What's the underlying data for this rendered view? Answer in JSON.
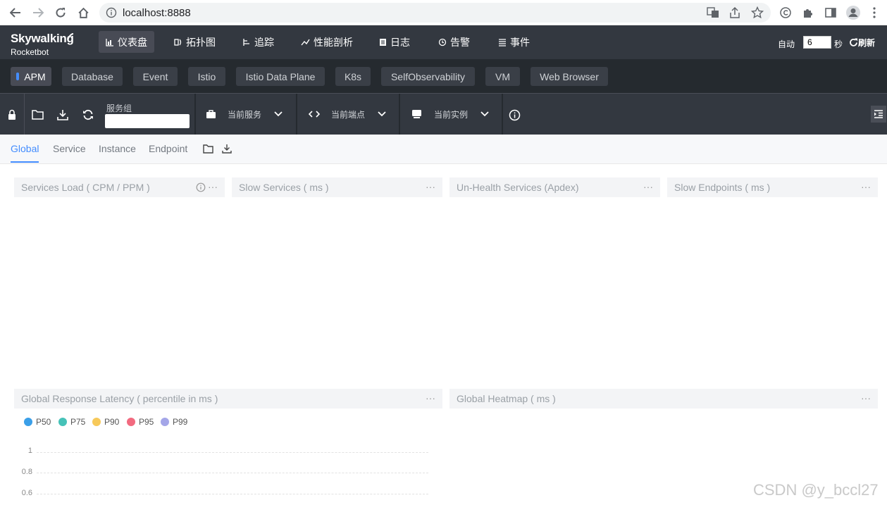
{
  "browser": {
    "url": "localhost:8888"
  },
  "app": {
    "logo_main": "Skywalking",
    "logo_sub": "Rocketbot",
    "nav": [
      {
        "label": "仪表盘",
        "icon": "bar-chart-icon",
        "active": true
      },
      {
        "label": "拓扑图",
        "icon": "topology-icon",
        "active": false
      },
      {
        "label": "追踪",
        "icon": "trace-icon",
        "active": false
      },
      {
        "label": "性能剖析",
        "icon": "profile-icon",
        "active": false
      },
      {
        "label": "日志",
        "icon": "log-icon",
        "active": false
      },
      {
        "label": "告警",
        "icon": "alarm-icon",
        "active": false
      },
      {
        "label": "事件",
        "icon": "event-icon",
        "active": false
      }
    ],
    "auto_label": "自动",
    "auto_value": "6",
    "seconds_label": "秒",
    "refresh_label": "刷新"
  },
  "tabs": [
    "APM",
    "Database",
    "Event",
    "Istio",
    "Istio Data Plane",
    "K8s",
    "SelfObservability",
    "VM",
    "Web Browser"
  ],
  "active_tab": "APM",
  "toolbar": {
    "group_label": "服务组",
    "group_value": "",
    "service_label": "当前服务",
    "endpoint_label": "当前端点",
    "instance_label": "当前实例"
  },
  "subtabs": [
    "Global",
    "Service",
    "Instance",
    "Endpoint"
  ],
  "active_subtab": "Global",
  "panels": {
    "services_load": "Services Load ( CPM / PPM )",
    "slow_services": "Slow Services ( ms )",
    "unhealth_services": "Un-Health Services (Apdex)",
    "slow_endpoints": "Slow Endpoints ( ms )",
    "global_latency": "Global Response Latency ( percentile in ms )",
    "global_heatmap": "Global Heatmap ( ms )",
    "more": "···"
  },
  "chart_data": {
    "type": "line",
    "title": "Global Response Latency ( percentile in ms )",
    "series": [
      {
        "name": "P50",
        "color": "#3a9fe8",
        "values": []
      },
      {
        "name": "P75",
        "color": "#46c2b8",
        "values": []
      },
      {
        "name": "P90",
        "color": "#f7c95a",
        "values": []
      },
      {
        "name": "P95",
        "color": "#f26a7f",
        "values": []
      },
      {
        "name": "P99",
        "color": "#a4a6e8",
        "values": []
      }
    ],
    "yticks": [
      "1",
      "0.8",
      "0.6"
    ],
    "legend": "top-left",
    "grid": true
  },
  "watermark": "CSDN @y_bccl27"
}
